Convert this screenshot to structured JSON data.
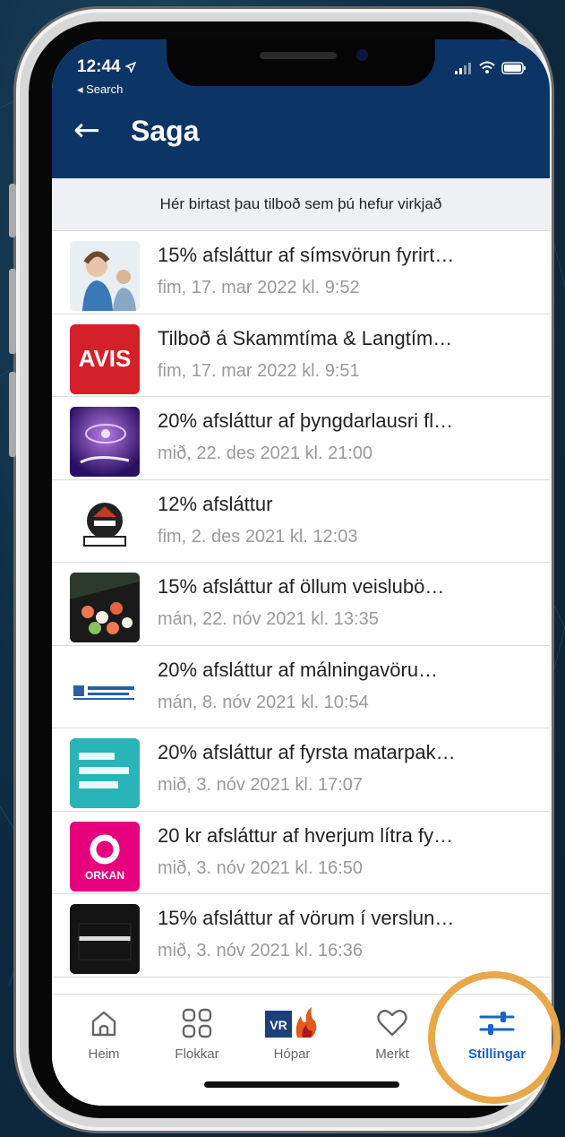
{
  "status_bar": {
    "time": "12:44",
    "back_app": "◂ Search"
  },
  "header": {
    "title": "Saga",
    "back_arrow": "←"
  },
  "banner": "Hér birtast þau tilboð sem þú hefur virkjað",
  "items": [
    {
      "title": "15% afsláttur af símsvörun fyrirt…",
      "date": "fim, 17. mar 2022 kl. 9:52",
      "thumb_label": "",
      "thumb_color": "#dfe8ee"
    },
    {
      "title": "Tilboð á Skammtíma & Langtím…",
      "date": "fim, 17. mar 2022 kl. 9:51",
      "thumb_label": "AVIS",
      "thumb_color": "#d42028"
    },
    {
      "title": "20% afsláttur af þyngdarlausri fl…",
      "date": "mið, 22. des 2021 kl. 21:00",
      "thumb_label": "",
      "thumb_color": "#4a2a8a"
    },
    {
      "title": "12% afsláttur",
      "date": "fim, 2. des 2021 kl. 12:03",
      "thumb_label": "",
      "thumb_color": "#ffffff"
    },
    {
      "title": "15% afsláttur af öllum veislubö…",
      "date": "mán, 22. nóv 2021 kl. 13:35",
      "thumb_label": "",
      "thumb_color": "#3a4a3a"
    },
    {
      "title": "20% afsláttur af málningavöru…",
      "date": "mán, 8. nóv 2021 kl. 10:54",
      "thumb_label": "",
      "thumb_color": "#ffffff"
    },
    {
      "title": "20% afsláttur af fyrsta matarpak…",
      "date": "mið, 3. nóv 2021 kl. 17:07",
      "thumb_label": "EINN & TVEIR & ÞELDA",
      "thumb_color": "#28b4b8"
    },
    {
      "title": "20 kr afsláttur af hverjum lítra fy…",
      "date": "mið, 3. nóv 2021 kl. 16:50",
      "thumb_label": "ORKAN",
      "thumb_color": "#e6007e"
    },
    {
      "title": "15% afsláttur af vörum í verslun…",
      "date": "mið, 3. nóv 2021 kl. 16:36",
      "thumb_label": "",
      "thumb_color": "#111111"
    }
  ],
  "tabs": [
    {
      "label": "Heim",
      "icon": "home-icon"
    },
    {
      "label": "Flokkar",
      "icon": "grid-icon"
    },
    {
      "label": "Hópar",
      "icon": "vr-logo-icon",
      "logo_text": "VR"
    },
    {
      "label": "Merkt",
      "icon": "heart-icon"
    },
    {
      "label": "Stillingar",
      "icon": "sliders-icon"
    }
  ],
  "colors": {
    "header_bg": "#0c3566",
    "active_tab": "#1c63c9",
    "highlight_ring": "#e6a84a"
  }
}
